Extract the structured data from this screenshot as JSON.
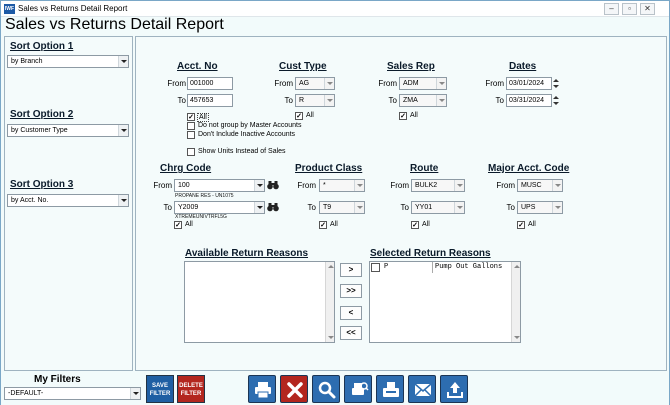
{
  "window": {
    "title": "Sales vs Returns Detail Report",
    "icon": "app-icon"
  },
  "heading": "Sales vs Returns Detail Report",
  "sort": [
    {
      "label": "Sort Option 1",
      "value": "by Branch"
    },
    {
      "label": "Sort Option 2",
      "value": "by Customer Type"
    },
    {
      "label": "Sort Option 3",
      "value": "by Acct. No."
    }
  ],
  "acct": {
    "header": "Acct. No",
    "from_label": "From",
    "to_label": "To",
    "from": "001000",
    "to": "457653",
    "all_label": "All",
    "all_checked": true,
    "no_group_label": "Do not group by Master Accounts",
    "no_group_checked": false,
    "no_inactive_label": "Don't Include Inactive Accounts",
    "no_inactive_checked": false
  },
  "cust_type": {
    "header": "Cust Type",
    "from_label": "From",
    "to_label": "To",
    "from": "AG",
    "to": "R",
    "all_label": "All",
    "all_checked": true
  },
  "sales_rep": {
    "header": "Sales Rep",
    "from_label": "From",
    "to_label": "To",
    "from": "ADM",
    "to": "ZMA",
    "all_label": "All",
    "all_checked": true
  },
  "dates": {
    "header": "Dates",
    "from_label": "From",
    "to_label": "To",
    "from": "03/01/2024",
    "to": "03/31/2024"
  },
  "show_units": {
    "label": "Show Units Instead of Sales",
    "checked": false
  },
  "chrg_code": {
    "header": "Chrg Code",
    "from_label": "From",
    "to_label": "To",
    "from": "100",
    "from_desc": "PROPANE RES - UN1075",
    "to": "Y2009",
    "to_desc": "XTREMEUNIVTRFL5G",
    "all_label": "All",
    "all_checked": true
  },
  "product_class": {
    "header": "Product Class",
    "from_label": "From",
    "to_label": "To",
    "from": "*",
    "to": "T9",
    "all_label": "All",
    "all_checked": true
  },
  "route": {
    "header": "Route",
    "from_label": "From",
    "to_label": "To",
    "from": "BULK2",
    "to": "YY01",
    "all_label": "All",
    "all_checked": true
  },
  "major_acct": {
    "header": "Major Acct. Code",
    "from_label": "From",
    "to_label": "To",
    "from": "MUSC",
    "to": "UPS",
    "all_label": "All",
    "all_checked": true
  },
  "available_reasons": {
    "header": "Available Return Reasons",
    "items": []
  },
  "selected_reasons": {
    "header": "Selected Return Reasons",
    "items": [
      {
        "code": "P",
        "desc": "Pump Out Gallons"
      }
    ]
  },
  "move_buttons": {
    "add": ">",
    "add_all": ">>",
    "remove": "<",
    "remove_all": "<<"
  },
  "my_filters": {
    "label": "My Filters",
    "value": "-DEFAULT-"
  },
  "filter_buttons": {
    "save_line1": "SAVE",
    "save_line2": "FILTER",
    "delete_line1": "DELETE",
    "delete_line2": "FILTER"
  },
  "toolbar": [
    "print-icon",
    "close-icon",
    "search-icon",
    "print-preview-icon",
    "fax-icon",
    "email-icon",
    "export-icon"
  ],
  "colors": {
    "accent_blue": "#1f5fa3",
    "delete_red": "#b3261e",
    "panel_bg": "#f4fbfb"
  }
}
